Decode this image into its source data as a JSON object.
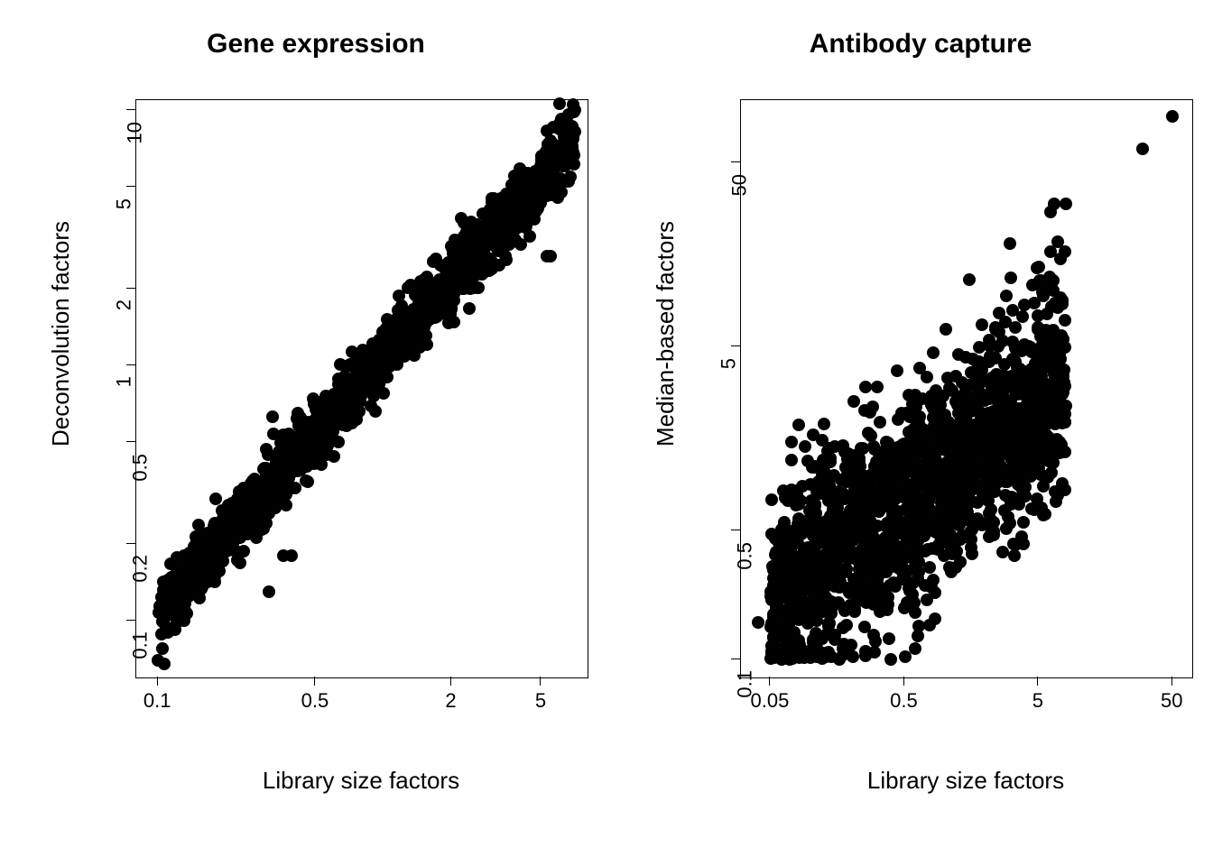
{
  "chart_data": [
    {
      "type": "scatter",
      "title": "Gene expression",
      "xlabel": "Library size factors",
      "ylabel": "Deconvolution factors",
      "xscale": "log",
      "yscale": "log",
      "xlim": [
        0.08,
        8.0
      ],
      "ylim": [
        0.06,
        11.0
      ],
      "xticks": [
        0.1,
        0.5,
        2.0,
        5.0
      ],
      "yticks": [
        0.1,
        0.2,
        0.5,
        1.0,
        2.0,
        5.0,
        10.0
      ],
      "note": "~1500 points along y ≈ x with moderate scatter; representative sample in 'points'",
      "points": [
        [
          0.1,
          0.07
        ],
        [
          0.11,
          0.09
        ],
        [
          0.11,
          0.13
        ],
        [
          0.12,
          0.11
        ],
        [
          0.12,
          0.15
        ],
        [
          0.13,
          0.13
        ],
        [
          0.13,
          0.1
        ],
        [
          0.14,
          0.14
        ],
        [
          0.15,
          0.16
        ],
        [
          0.15,
          0.13
        ],
        [
          0.16,
          0.17
        ],
        [
          0.16,
          0.19
        ],
        [
          0.17,
          0.15
        ],
        [
          0.17,
          0.2
        ],
        [
          0.18,
          0.18
        ],
        [
          0.18,
          0.22
        ],
        [
          0.19,
          0.2
        ],
        [
          0.2,
          0.23
        ],
        [
          0.2,
          0.19
        ],
        [
          0.21,
          0.22
        ],
        [
          0.22,
          0.25
        ],
        [
          0.22,
          0.21
        ],
        [
          0.23,
          0.26
        ],
        [
          0.24,
          0.24
        ],
        [
          0.25,
          0.28
        ],
        [
          0.25,
          0.23
        ],
        [
          0.26,
          0.3
        ],
        [
          0.27,
          0.27
        ],
        [
          0.28,
          0.32
        ],
        [
          0.29,
          0.29
        ],
        [
          0.3,
          0.34
        ],
        [
          0.3,
          0.27
        ],
        [
          0.31,
          0.13
        ],
        [
          0.32,
          0.35
        ],
        [
          0.33,
          0.33
        ],
        [
          0.34,
          0.38
        ],
        [
          0.35,
          0.36
        ],
        [
          0.36,
          0.18
        ],
        [
          0.37,
          0.42
        ],
        [
          0.38,
          0.4
        ],
        [
          0.39,
          0.18
        ],
        [
          0.4,
          0.45
        ],
        [
          0.41,
          0.43
        ],
        [
          0.42,
          0.48
        ],
        [
          0.43,
          0.46
        ],
        [
          0.44,
          0.5
        ],
        [
          0.45,
          0.42
        ],
        [
          0.47,
          0.55
        ],
        [
          0.48,
          0.52
        ],
        [
          0.5,
          0.58
        ],
        [
          0.52,
          0.55
        ],
        [
          0.54,
          0.62
        ],
        [
          0.56,
          0.6
        ],
        [
          0.58,
          0.67
        ],
        [
          0.6,
          0.65
        ],
        [
          0.62,
          0.72
        ],
        [
          0.64,
          0.7
        ],
        [
          0.66,
          0.77
        ],
        [
          0.68,
          0.75
        ],
        [
          0.7,
          0.82
        ],
        [
          0.72,
          0.8
        ],
        [
          0.75,
          0.88
        ],
        [
          0.78,
          0.86
        ],
        [
          0.8,
          0.95
        ],
        [
          0.83,
          0.92
        ],
        [
          0.86,
          1.02
        ],
        [
          0.9,
          1.0
        ],
        [
          0.93,
          1.1
        ],
        [
          0.97,
          1.08
        ],
        [
          1.0,
          1.18
        ],
        [
          1.04,
          1.15
        ],
        [
          1.08,
          1.28
        ],
        [
          1.12,
          1.25
        ],
        [
          1.16,
          1.36
        ],
        [
          1.2,
          1.34
        ],
        [
          1.25,
          1.48
        ],
        [
          1.3,
          1.45
        ],
        [
          1.35,
          1.6
        ],
        [
          1.4,
          1.56
        ],
        [
          1.46,
          1.72
        ],
        [
          1.52,
          1.68
        ],
        [
          1.58,
          1.84
        ],
        [
          1.64,
          1.8
        ],
        [
          1.7,
          2.0
        ],
        [
          1.77,
          1.95
        ],
        [
          1.84,
          2.15
        ],
        [
          1.91,
          2.1
        ],
        [
          1.98,
          2.3
        ],
        [
          2.06,
          2.25
        ],
        [
          2.14,
          2.48
        ],
        [
          2.23,
          2.43
        ],
        [
          2.32,
          2.68
        ],
        [
          2.41,
          2.62
        ],
        [
          2.51,
          2.9
        ],
        [
          2.61,
          2.83
        ],
        [
          2.71,
          3.13
        ],
        [
          2.82,
          3.05
        ],
        [
          2.93,
          3.38
        ],
        [
          3.05,
          3.3
        ],
        [
          3.17,
          3.65
        ],
        [
          3.3,
          3.56
        ],
        [
          3.43,
          3.94
        ],
        [
          3.57,
          3.84
        ],
        [
          3.71,
          4.26
        ],
        [
          3.86,
          4.15
        ],
        [
          4.01,
          4.6
        ],
        [
          4.17,
          4.48
        ],
        [
          4.34,
          4.96
        ],
        [
          4.52,
          4.84
        ],
        [
          4.7,
          5.36
        ],
        [
          4.89,
          5.22
        ],
        [
          5.08,
          5.7
        ],
        [
          5.29,
          2.7
        ],
        [
          5.5,
          2.7
        ],
        [
          5.72,
          6.3
        ],
        [
          5.95,
          6.1
        ],
        [
          6.2,
          8.5
        ],
        [
          6.45,
          5.3
        ],
        [
          6.7,
          5.5
        ],
        [
          7.0,
          8.3
        ]
      ]
    },
    {
      "type": "scatter",
      "title": "Antibody capture",
      "xlabel": "Library size factors",
      "ylabel": "Median-based factors",
      "xscale": "log",
      "yscale": "log",
      "xlim": [
        0.03,
        70.0
      ],
      "ylim": [
        0.08,
        110.0
      ],
      "xticks": [
        0.05,
        0.5,
        5.0,
        50.0
      ],
      "yticks": [
        0.1,
        0.5,
        5.0,
        50.0
      ],
      "note": "dense cloud centred near (1,1) with broad scatter and upper-right outliers; representative sample in 'points'",
      "points": [
        [
          0.04,
          0.16
        ],
        [
          0.05,
          0.15
        ],
        [
          0.05,
          0.22
        ],
        [
          0.06,
          0.18
        ],
        [
          0.06,
          0.26
        ],
        [
          0.07,
          0.2
        ],
        [
          0.07,
          0.3
        ],
        [
          0.08,
          0.24
        ],
        [
          0.08,
          0.35
        ],
        [
          0.09,
          0.28
        ],
        [
          0.1,
          0.4
        ],
        [
          0.1,
          0.17
        ],
        [
          0.11,
          0.32
        ],
        [
          0.12,
          0.45
        ],
        [
          0.12,
          0.2
        ],
        [
          0.13,
          0.38
        ],
        [
          0.14,
          0.52
        ],
        [
          0.15,
          0.25
        ],
        [
          0.16,
          0.44
        ],
        [
          0.17,
          0.6
        ],
        [
          0.18,
          0.3
        ],
        [
          0.19,
          0.5
        ],
        [
          0.2,
          0.12
        ],
        [
          0.21,
          0.7
        ],
        [
          0.22,
          0.35
        ],
        [
          0.24,
          0.58
        ],
        [
          0.25,
          0.15
        ],
        [
          0.27,
          0.8
        ],
        [
          0.28,
          0.4
        ],
        [
          0.3,
          0.11
        ],
        [
          0.32,
          0.67
        ],
        [
          0.34,
          0.93
        ],
        [
          0.36,
          0.46
        ],
        [
          0.38,
          0.13
        ],
        [
          0.4,
          0.78
        ],
        [
          0.43,
          1.08
        ],
        [
          0.45,
          0.54
        ],
        [
          0.48,
          0.3
        ],
        [
          0.51,
          0.9
        ],
        [
          0.54,
          1.25
        ],
        [
          0.57,
          0.62
        ],
        [
          0.6,
          0.18
        ],
        [
          0.64,
          0.3
        ],
        [
          0.68,
          1.05
        ],
        [
          0.72,
          1.45
        ],
        [
          0.76,
          0.72
        ],
        [
          0.8,
          0.4
        ],
        [
          0.85,
          1.21
        ],
        [
          0.9,
          1.67
        ],
        [
          0.95,
          0.84
        ],
        [
          1.0,
          0.5
        ],
        [
          1.06,
          1.4
        ],
        [
          1.12,
          0.3
        ],
        [
          1.19,
          0.97
        ],
        [
          1.26,
          0.6
        ],
        [
          1.33,
          1.63
        ],
        [
          1.41,
          2.25
        ],
        [
          1.49,
          1.12
        ],
        [
          1.58,
          0.72
        ],
        [
          1.67,
          1.88
        ],
        [
          1.77,
          2.6
        ],
        [
          1.87,
          1.3
        ],
        [
          1.98,
          0.85
        ],
        [
          2.1,
          2.18
        ],
        [
          2.22,
          3.01
        ],
        [
          2.35,
          1.5
        ],
        [
          2.49,
          1.0
        ],
        [
          2.63,
          2.53
        ],
        [
          2.78,
          3.49
        ],
        [
          2.95,
          1.74
        ],
        [
          3.12,
          0.7
        ],
        [
          3.3,
          2.93
        ],
        [
          3.49,
          0.9
        ],
        [
          3.69,
          2.01
        ],
        [
          3.9,
          1.4
        ],
        [
          4.13,
          3.39
        ],
        [
          4.37,
          1.0
        ],
        [
          4.62,
          2.33
        ],
        [
          4.89,
          1.6
        ],
        [
          5.17,
          3.9
        ],
        [
          5.47,
          2.7
        ],
        [
          5.79,
          1.9
        ],
        [
          6.0,
          1.2
        ],
        [
          6.0,
          12.0
        ],
        [
          6.5,
          30.0
        ],
        [
          8.0,
          30.0
        ],
        [
          30.0,
          60.0
        ],
        [
          50.0,
          90.0
        ]
      ]
    }
  ]
}
